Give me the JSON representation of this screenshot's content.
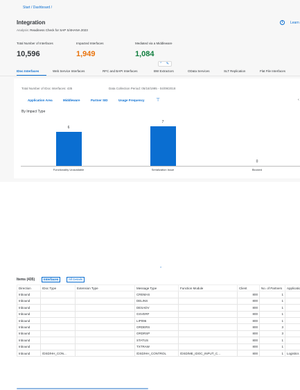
{
  "header": {
    "breadcrumb": "Start / Dashboard /",
    "title": "Integration",
    "subtitle_prefix": "Analysis:",
    "subtitle_value": "Readiness Check for SAP S/4HANA 2023",
    "learn_more": "Learn"
  },
  "kpis": [
    {
      "label": "Total Number of Interfaces",
      "value": "10,596",
      "color": "#32363a"
    },
    {
      "label": "Impacted Interfaces",
      "value": "1,949",
      "color": "#e9730c"
    },
    {
      "label": "Mediated via a Middleware",
      "value": "1,084",
      "color": "#107e3e"
    }
  ],
  "collapse_glyph": "⌃ ✎",
  "tabs": [
    {
      "label": "IDoc Interfaces"
    },
    {
      "label": "Web Service Interfaces"
    },
    {
      "label": "RFC and BAPI Interfaces"
    },
    {
      "label": "BW Extractors"
    },
    {
      "label": "OData Services"
    },
    {
      "label": "SLT Replication"
    },
    {
      "label": "Flat File Interfaces"
    }
  ],
  "panel": {
    "total_label": "Total Number of IDoc Interfaces: 435",
    "period_label": "Data Collection Period: 05/18/1995 - 04/09/2018",
    "filters": [
      "Application Area",
      "Middleware",
      "Partner SID",
      "Usage Frequency"
    ],
    "filter_icon": "filter-icon",
    "chart_title": "By Impact Type"
  },
  "chart_data": {
    "type": "bar",
    "title": "By Impact Type",
    "categories": [
      "Functionality Unavailable",
      "Serialization Issue",
      "Blocked"
    ],
    "values": [
      6,
      7,
      0
    ],
    "value_labels": [
      "6",
      "7",
      "0"
    ],
    "ylim": [
      0,
      7
    ],
    "color": "#0a6ed1",
    "grid": false
  },
  "items": {
    "title": "Items (435)",
    "segments": [
      "Interfaces",
      "All Details"
    ],
    "columns": [
      "Direction",
      "IDoc Type",
      "Extension Type",
      "Message Type",
      "Function Module",
      "Client",
      "No. of Partners",
      "Application"
    ],
    "rows": [
      [
        "Inbound",
        "",
        "",
        "CREMAS",
        "",
        "800",
        "1",
        ""
      ],
      [
        "Inbound",
        "",
        "",
        "DELINS",
        "",
        "800",
        "1",
        ""
      ],
      [
        "Inbound",
        "",
        "",
        "DESADV",
        "",
        "800",
        "1",
        ""
      ],
      [
        "Inbound",
        "",
        "",
        "GSVERF",
        "",
        "800",
        "1",
        ""
      ],
      [
        "Inbound",
        "",
        "",
        "LIP096",
        "",
        "800",
        "1",
        ""
      ],
      [
        "Inbound",
        "",
        "",
        "ORDERS",
        "",
        "800",
        "3",
        ""
      ],
      [
        "Inbound",
        "",
        "",
        "ORDRSP",
        "",
        "800",
        "3",
        ""
      ],
      [
        "Inbound",
        "",
        "",
        "STATUS",
        "",
        "800",
        "1",
        ""
      ],
      [
        "Inbound",
        "",
        "",
        "TXTRAW",
        "",
        "800",
        "1",
        ""
      ],
      [
        "Inbound",
        "/DSD/HH_CON...",
        "",
        "/DSD/HH_CONTROL",
        "/DSD/ME_IDOC_INPUT_C...",
        "800",
        "1",
        "Logistics Ex"
      ]
    ]
  }
}
